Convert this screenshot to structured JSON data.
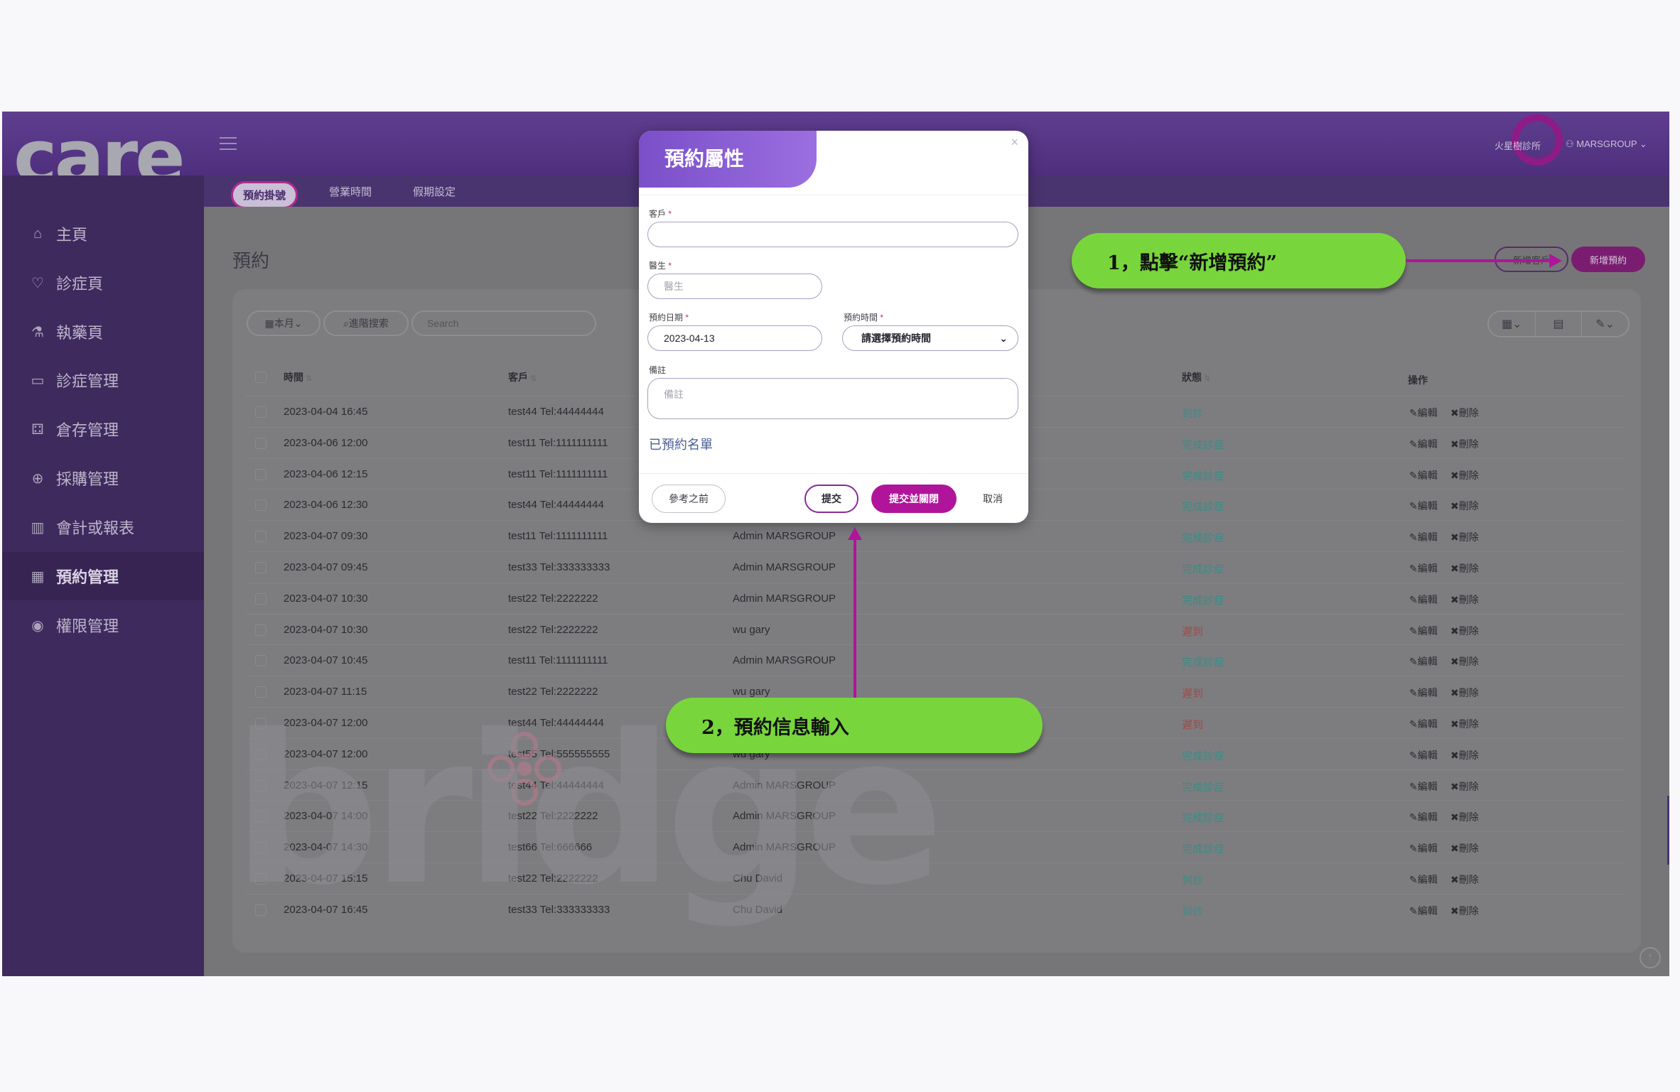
{
  "header": {
    "logo": "care",
    "clinic_name": "火星樹診所",
    "user": "MARSGROUP"
  },
  "sidebar": {
    "items": [
      {
        "label": "主頁",
        "icon": "home-icon",
        "glyph": "⌂"
      },
      {
        "label": "診症頁",
        "icon": "heart-icon",
        "glyph": "♡"
      },
      {
        "label": "執藥頁",
        "icon": "pestle-icon",
        "glyph": "⚗"
      },
      {
        "label": "診症管理",
        "icon": "card-icon",
        "glyph": "▭"
      },
      {
        "label": "倉存管理",
        "icon": "boxes-icon",
        "glyph": "⚃"
      },
      {
        "label": "採購管理",
        "icon": "plus-circle-icon",
        "glyph": "⊕"
      },
      {
        "label": "會計或報表",
        "icon": "bar-chart-icon",
        "glyph": "▥"
      },
      {
        "label": "預約管理",
        "icon": "calendar-icon",
        "glyph": "▦"
      },
      {
        "label": "權限管理",
        "icon": "badge-icon",
        "glyph": "◉"
      }
    ],
    "active": "預約管理"
  },
  "subnav": {
    "tabs": [
      "預約掛號",
      "營業時間",
      "假期設定"
    ],
    "active": "預約掛號"
  },
  "page": {
    "title": "預約",
    "new_customer_label": "新增客戶",
    "new_appointment_label": "新增預約",
    "month_filter": "本月",
    "advanced_search": "進階搜索",
    "search_placeholder": "Search"
  },
  "table": {
    "headers": {
      "time": "時間",
      "customer": "客戶",
      "status": "狀態",
      "actions": "操作"
    },
    "edit_label": "編輯",
    "delete_label": "刪除",
    "rows": [
      {
        "time": "2023-04-04 16:45",
        "customer": "test44 Tel:44444444",
        "doctor": "",
        "status": "到診",
        "tone": "teal"
      },
      {
        "time": "2023-04-06 12:00",
        "customer": "test11 Tel:1111111111",
        "doctor": "",
        "status": "完成診症",
        "tone": "teal"
      },
      {
        "time": "2023-04-06 12:15",
        "customer": "test11 Tel:1111111111",
        "doctor": "",
        "status": "完成診症",
        "tone": "teal"
      },
      {
        "time": "2023-04-06 12:30",
        "customer": "test44 Tel:44444444",
        "doctor": "",
        "status": "完成診症",
        "tone": "teal"
      },
      {
        "time": "2023-04-07 09:30",
        "customer": "test11 Tel:1111111111",
        "doctor": "Admin MARSGROUP",
        "status": "完成診症",
        "tone": "teal"
      },
      {
        "time": "2023-04-07 09:45",
        "customer": "test33 Tel:333333333",
        "doctor": "Admin MARSGROUP",
        "status": "完成診症",
        "tone": "teal"
      },
      {
        "time": "2023-04-07 10:30",
        "customer": "test22 Tel:2222222",
        "doctor": "Admin MARSGROUP",
        "status": "完成診症",
        "tone": "teal"
      },
      {
        "time": "2023-04-07 10:30",
        "customer": "test22 Tel:2222222",
        "doctor": "wu gary",
        "status": "遲到",
        "tone": "red"
      },
      {
        "time": "2023-04-07 10:45",
        "customer": "test11 Tel:1111111111",
        "doctor": "Admin MARSGROUP",
        "status": "完成診症",
        "tone": "teal"
      },
      {
        "time": "2023-04-07 11:15",
        "customer": "test22 Tel:2222222",
        "doctor": "wu gary",
        "status": "遲到",
        "tone": "red"
      },
      {
        "time": "2023-04-07 12:00",
        "customer": "test44 Tel:44444444",
        "doctor": "",
        "status": "遲到",
        "tone": "red"
      },
      {
        "time": "2023-04-07 12:00",
        "customer": "test55 Tel:555555555",
        "doctor": "wu gary",
        "status": "完成診症",
        "tone": "teal"
      },
      {
        "time": "2023-04-07 12:15",
        "customer": "test44 Tel:44444444",
        "doctor": "Admin MARSGROUP",
        "status": "完成診症",
        "tone": "teal"
      },
      {
        "time": "2023-04-07 14:00",
        "customer": "test22 Tel:2222222",
        "doctor": "Admin MARSGROUP",
        "status": "完成診症",
        "tone": "teal"
      },
      {
        "time": "2023-04-07 14:30",
        "customer": "test66 Tel:666666",
        "doctor": "Admin MARSGROUP",
        "status": "完成診症",
        "tone": "teal"
      },
      {
        "time": "2023-04-07 15:15",
        "customer": "test22 Tel:2222222",
        "doctor": "Chu David",
        "status": "到診",
        "tone": "teal"
      },
      {
        "time": "2023-04-07 16:45",
        "customer": "test33 Tel:333333333",
        "doctor": "Chu David",
        "status": "到診",
        "tone": "teal"
      }
    ]
  },
  "watermark": "bridge",
  "modal": {
    "title": "預約屬性",
    "close": "×",
    "customer_label": "客戶",
    "customer_value": "",
    "doctor_label": "醫生",
    "doctor_placeholder": "醫生",
    "date_label": "預約日期",
    "date_value": "2023-04-13",
    "time_label": "預約時間",
    "time_value": "請選擇預約時間",
    "notes_label": "備註",
    "notes_placeholder": "備註",
    "booked_list_link": "已預約名單",
    "reference_button": "參考之前",
    "submit_button": "提交",
    "submit_close_button": "提交並關閉",
    "cancel_button": "取消",
    "required_mark": "*"
  },
  "annotations": {
    "step1": "1，點擊“新增預約”",
    "step2": "2，預約信息輸入"
  },
  "colors": {
    "header_purple": "#5f3e8f",
    "sidebar_purple": "#3f2a5e",
    "accent_magenta": "#b0149a",
    "callout_green": "#78d63c",
    "status_teal": "#3b8c84",
    "status_red": "#a04a4a"
  }
}
